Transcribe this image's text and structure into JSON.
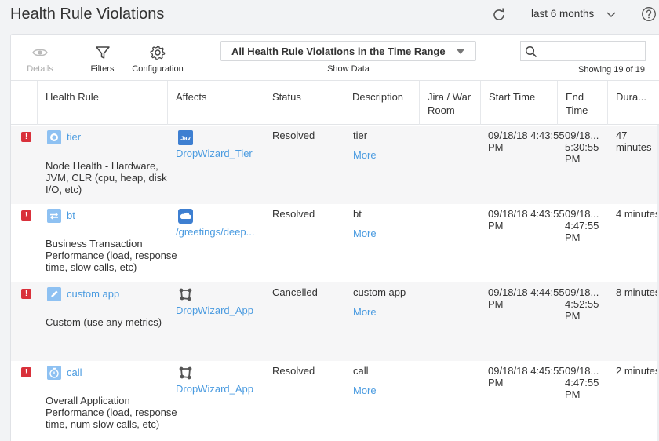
{
  "header": {
    "title": "Health Rule Violations",
    "time_range": "last 6 months",
    "icons": {
      "refresh": "refresh-icon",
      "chevron": "chevron-down-icon",
      "help": "help-icon"
    }
  },
  "toolbar": {
    "details_label": "Details",
    "filters_label": "Filters",
    "configuration_label": "Configuration",
    "show_data_select_value": "All Health Rule Violations in the Time Range",
    "show_data_label": "Show Data",
    "search_placeholder": "",
    "showing_text": "Showing 19 of 19"
  },
  "table": {
    "columns": [
      "",
      "Health Rule",
      "Affects",
      "Status",
      "Description",
      "Jira / War Room",
      "Start Time",
      "End Time",
      "Dura..."
    ],
    "rows": [
      {
        "severity": "!",
        "rule_icon": "tier-node-icon",
        "rule_name": "tier",
        "rule_type": "Node Health - Hardware, JVM, CLR (cpu, heap, disk I/O, etc)",
        "affects_icon": "java-tier-icon",
        "affects_icon_text": "Jav",
        "affects": "DropWizard_Tier",
        "status": "Resolved",
        "description": "tier",
        "more": "More",
        "jira": "",
        "start_time": "09/18/18 4:43:55 PM",
        "end_time": "09/18... 5:30:55 PM",
        "duration": "47 minutes"
      },
      {
        "severity": "!",
        "rule_icon": "business-transaction-icon",
        "rule_name": "bt",
        "rule_type": "Business Transaction Performance (load, response time, slow calls, etc)",
        "affects_icon": "cloud-icon",
        "affects": "/greetings/deep...",
        "status": "Resolved",
        "description": "bt",
        "more": "More",
        "jira": "",
        "start_time": "09/18/18 4:43:55 PM",
        "end_time": "09/18... 4:47:55 PM",
        "duration": "4 minutes"
      },
      {
        "severity": "!",
        "rule_icon": "pencil-icon",
        "rule_name": "custom app",
        "rule_type": "Custom (use any metrics)",
        "affects_icon": "application-icon",
        "affects": "DropWizard_App",
        "status": "Cancelled",
        "description": "custom app",
        "more": "More",
        "jira": "",
        "start_time": "09/18/18 4:44:55 PM",
        "end_time": "09/18... 4:52:55 PM",
        "duration": "8 minutes"
      },
      {
        "severity": "!",
        "rule_icon": "stopwatch-icon",
        "rule_name": "call",
        "rule_type": "Overall Application Performance (load, response time, num slow calls, etc)",
        "affects_icon": "application-icon",
        "affects": "DropWizard_App",
        "status": "Resolved",
        "description": "call",
        "more": "More",
        "jira": "",
        "start_time": "09/18/18 4:45:55 PM",
        "end_time": "09/18... 4:47:55 PM",
        "duration": "2 minutes"
      }
    ]
  },
  "colors": {
    "link": "#4a9be0",
    "error": "#d9313b",
    "rule_icon_bg": "#8ec1f2",
    "affects_icon": "#3e7fd1"
  }
}
